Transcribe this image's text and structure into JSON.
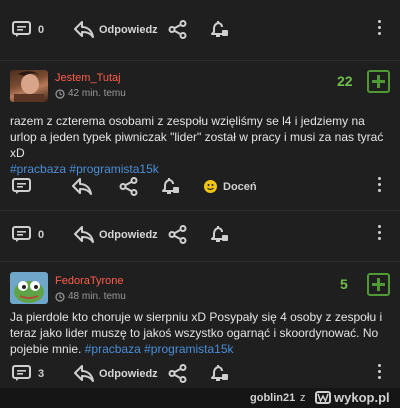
{
  "actions": {
    "reply_label": "Odpowiedz"
  },
  "top_comment": {
    "reply_count": "0"
  },
  "comment1": {
    "username": "Jestem_Tutaj",
    "time": "42 min. temu",
    "score": "22",
    "text": "razem z czterema osobami z zespołu wzięliśmy se l4 i jedziemy na urlop a jeden typek piwniczak \"lider\" został w pracy i musi za nas tyrać xD",
    "tags": [
      "#pracbaza",
      "#programista15k"
    ],
    "appreciate_label": "Doceń"
  },
  "comment2": {
    "reply_count": "0"
  },
  "comment3": {
    "username": "FedoraTyrone",
    "time": "48 min. temu",
    "score": "5",
    "text": "Ja pierdole kto choruje w sierpniu xD Posypały się 4 osoby z zespołu i teraz jako lider muszę to jakoś wszystko ogarnąć i skoordynować. No pojebie mnie.",
    "tags": [
      "#pracbaza",
      "#programista15k"
    ],
    "reply_count": "3"
  },
  "footer": {
    "user": "goblin21",
    "connector": "z",
    "site": "wykop.pl"
  },
  "colors": {
    "background": "#151515",
    "card": "#1f1f1f",
    "username": "#ff5d4a",
    "tag": "#4a8ed8",
    "score": "#6fbf4a"
  }
}
